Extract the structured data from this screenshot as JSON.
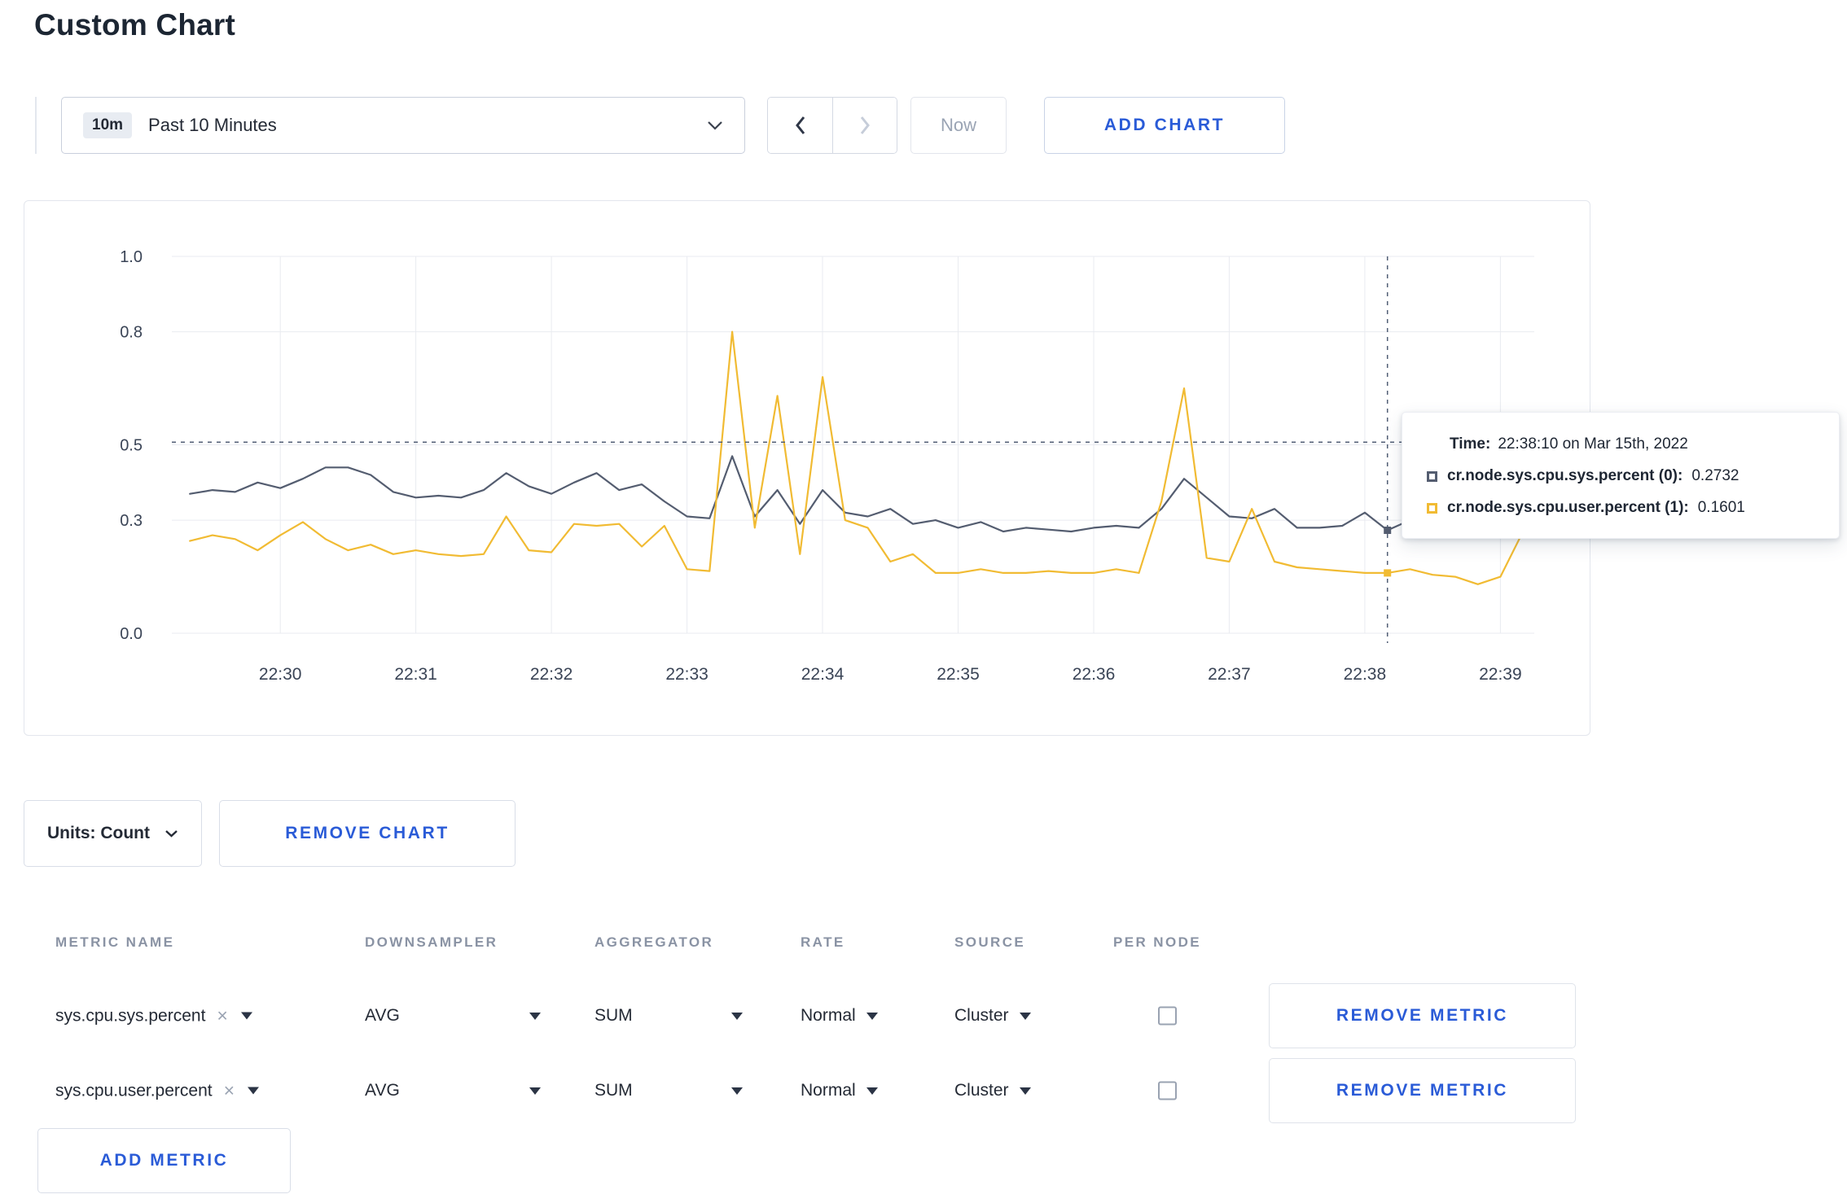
{
  "page": {
    "title": "Custom Chart"
  },
  "colors": {
    "accent_blue": "#2a5bd7",
    "series_sys": "#545d70",
    "series_user": "#f1bb33",
    "grid": "#e9ebf0",
    "crosshair": "#515e75"
  },
  "toolbar": {
    "range_badge": "10m",
    "range_label": "Past 10 Minutes",
    "now_label": "Now",
    "add_chart_label": "ADD CHART"
  },
  "chart_data": {
    "type": "line",
    "title": "",
    "xlabel": "",
    "ylabel": "",
    "ylim": [
      0,
      1.0
    ],
    "grid": true,
    "x_tick_labels": [
      "22:30",
      "22:31",
      "22:32",
      "22:33",
      "22:34",
      "22:35",
      "22:36",
      "22:37",
      "22:38",
      "22:39"
    ],
    "x_tick_minutes": [
      30,
      31,
      32,
      33,
      34,
      35,
      36,
      37,
      38,
      39
    ],
    "y_tick_values": [
      0,
      0.3,
      0.5,
      0.8,
      1.0
    ],
    "y_tick_labels": [
      "0.0",
      "0.3",
      "0.5",
      "0.8",
      "1.0"
    ],
    "x_start_minute": 29.3333,
    "x_step_minutes": 0.16667,
    "series": [
      {
        "name": "cr.node.sys.cpu.sys.percent",
        "color": "#545d70",
        "values": [
          0.37,
          0.38,
          0.375,
          0.4,
          0.385,
          0.41,
          0.44,
          0.44,
          0.42,
          0.375,
          0.36,
          0.365,
          0.36,
          0.38,
          0.425,
          0.39,
          0.37,
          0.4,
          0.425,
          0.38,
          0.395,
          0.35,
          0.31,
          0.305,
          0.47,
          0.31,
          0.38,
          0.29,
          0.38,
          0.32,
          0.31,
          0.33,
          0.29,
          0.3,
          0.28,
          0.295,
          0.27,
          0.28,
          0.275,
          0.27,
          0.28,
          0.285,
          0.28,
          0.33,
          0.41,
          0.36,
          0.31,
          0.305,
          0.33,
          0.28,
          0.28,
          0.285,
          0.32,
          0.2732,
          0.3,
          0.31,
          0.3,
          0.295,
          0.3,
          0.33
        ]
      },
      {
        "name": "cr.node.sys.cpu.user.percent",
        "color": "#f1bb33",
        "values": [
          0.245,
          0.26,
          0.25,
          0.22,
          0.26,
          0.295,
          0.25,
          0.22,
          0.235,
          0.21,
          0.22,
          0.21,
          0.205,
          0.21,
          0.31,
          0.22,
          0.215,
          0.29,
          0.285,
          0.29,
          0.23,
          0.285,
          0.17,
          0.165,
          0.8,
          0.28,
          0.63,
          0.21,
          0.68,
          0.3,
          0.28,
          0.19,
          0.21,
          0.16,
          0.16,
          0.17,
          0.16,
          0.16,
          0.165,
          0.16,
          0.16,
          0.17,
          0.16,
          0.35,
          0.65,
          0.2,
          0.19,
          0.33,
          0.19,
          0.175,
          0.17,
          0.165,
          0.16,
          0.1601,
          0.17,
          0.155,
          0.15,
          0.13,
          0.15,
          0.27
        ]
      }
    ],
    "crosshair": {
      "x_minute": 38.1667,
      "y_value": 0.507
    },
    "hover_points": [
      {
        "series": 0,
        "x_minute": 38.1667,
        "y_value": 0.2732
      },
      {
        "series": 1,
        "x_minute": 38.1667,
        "y_value": 0.1601
      }
    ],
    "legend_position": "tooltip"
  },
  "tooltip": {
    "time_label": "Time:",
    "time_value": "22:38:10 on Mar 15th, 2022",
    "rows": [
      {
        "label": "cr.node.sys.cpu.sys.percent (0):",
        "value": "0.2732",
        "color": "#545d70"
      },
      {
        "label": "cr.node.sys.cpu.user.percent (1):",
        "value": "0.1601",
        "color": "#f1bb33"
      }
    ]
  },
  "controls": {
    "units_label": "Units: Count",
    "remove_chart_label": "REMOVE CHART",
    "add_metric_label": "ADD METRIC"
  },
  "metrics_table": {
    "headers": [
      "METRIC NAME",
      "DOWNSAMPLER",
      "AGGREGATOR",
      "RATE",
      "SOURCE",
      "PER NODE"
    ],
    "rows": [
      {
        "metric": "sys.cpu.sys.percent",
        "downsampler": "AVG",
        "aggregator": "SUM",
        "rate": "Normal",
        "source": "Cluster",
        "per_node": false,
        "remove_label": "REMOVE METRIC"
      },
      {
        "metric": "sys.cpu.user.percent",
        "downsampler": "AVG",
        "aggregator": "SUM",
        "rate": "Normal",
        "source": "Cluster",
        "per_node": false,
        "remove_label": "REMOVE METRIC"
      }
    ]
  }
}
